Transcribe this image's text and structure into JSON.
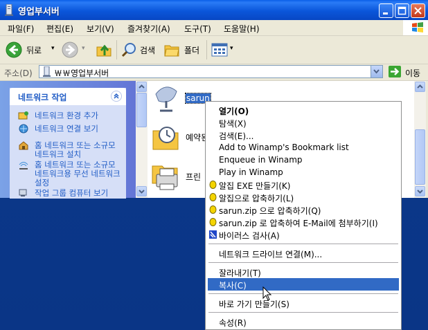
{
  "window": {
    "title": "영업부서버",
    "menu": [
      "파일(F)",
      "편집(E)",
      "보기(V)",
      "즐겨찾기(A)",
      "도구(T)",
      "도움말(H)"
    ]
  },
  "toolbar": {
    "back_label": "뒤로",
    "search_label": "검색",
    "folders_label": "폴더"
  },
  "address": {
    "label": "주소(D)",
    "value": "￦￦영업부서버",
    "go_label": "이동"
  },
  "taskpane": {
    "header": "네트워크 작업",
    "links": [
      "네트워크 환경 추가",
      "네트워크 연결 보기",
      "홈 네트워크 또는 소규모 네트워크 설치",
      "홈 네트워크 또는 소규모 네트워크용 무선 네트워크 설정",
      "작업 그룹 컴퓨터 보기"
    ]
  },
  "content": {
    "items": [
      {
        "label": "sarun",
        "icon": "network-share-icon"
      },
      {
        "label": "예약된",
        "icon": "scheduled-tasks-icon"
      },
      {
        "label": "프린",
        "icon": "printers-icon"
      }
    ]
  },
  "context_menu": {
    "items": [
      {
        "label": "열기(O)",
        "bold": true
      },
      {
        "label": "탐색(X)"
      },
      {
        "label": "검색(E)..."
      },
      {
        "label": "Add to Winamp's Bookmark list"
      },
      {
        "label": "Enqueue in Winamp"
      },
      {
        "label": "Play in Winamp"
      },
      {
        "label": "알집 EXE 만들기(K)",
        "icon": "alzip-icon"
      },
      {
        "label": "알집으로 압축하기(L)",
        "icon": "alzip-icon"
      },
      {
        "label": "sarun.zip 으로 압축하기(Q)",
        "icon": "alzip-icon"
      },
      {
        "label": "sarun.zip 로 압축하여 E-Mail에 첨부하기(I)",
        "icon": "alzip-icon"
      },
      {
        "label": "바이러스 검사(A)",
        "icon": "virus-scan-icon"
      },
      {
        "label": "네트워크 드라이브 연결(M)..."
      },
      {
        "label": "잘라내기(T)"
      },
      {
        "label": "복사(C)",
        "highlighted": true
      },
      {
        "label": "바로 가기 만들기(S)"
      },
      {
        "label": "속성(R)"
      }
    ]
  },
  "colors": {
    "titlebar": "#0a56da",
    "selection": "#316ac5",
    "taskpane_link": "#215dc6",
    "desktop": "#0c3a8c"
  }
}
